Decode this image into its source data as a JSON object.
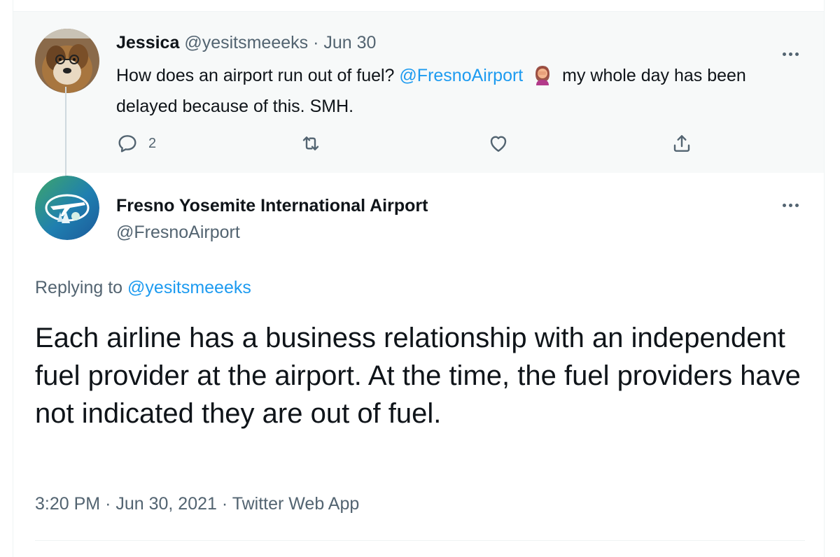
{
  "parent_tweet": {
    "display_name": "Jessica",
    "handle": "@yesitsmeeeks",
    "separator": "·",
    "date": "Jun 30",
    "text_before": "How does an airport run out of fuel?",
    "mention": "@FresnoAirport",
    "emoji": "woman-facepalming-emoji",
    "text_after": "my whole day has been delayed because of this. SMH.",
    "reply_count": "2",
    "actions": [
      "reply-icon",
      "retweet-icon",
      "like-icon",
      "share-icon"
    ]
  },
  "reply_tweet": {
    "display_name": "Fresno Yosemite International Airport",
    "handle": "@FresnoAirport",
    "replying_label": "Replying to",
    "replying_handle": "@yesitsmeeeks",
    "text": "Each airline has a business relationship with an independent fuel provider at the airport. At the time, the fuel providers have not indicated they are out of fuel.",
    "time": "3:20 PM",
    "date": "Jun 30, 2021",
    "source": "Twitter Web App",
    "separator": "·"
  },
  "colors": {
    "link": "#1d9bf0",
    "muted": "#536471",
    "text": "#0f1419",
    "highlight_bg": "#f7f9f9"
  }
}
